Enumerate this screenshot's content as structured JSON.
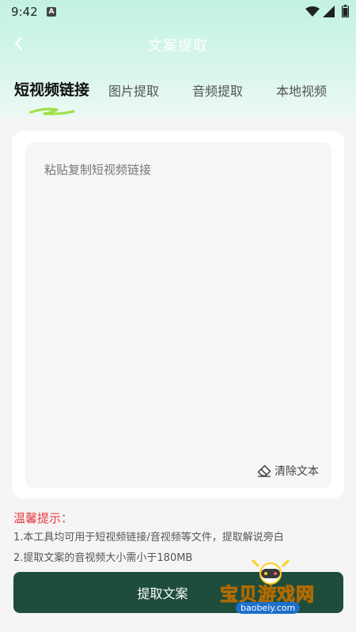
{
  "status_bar": {
    "time": "9:42",
    "app_badge": "A"
  },
  "header": {
    "title": "文案提取",
    "back_icon": "chevron-left-icon"
  },
  "tabs": [
    {
      "label": "短视频链接",
      "active": true
    },
    {
      "label": "图片提取",
      "active": false
    },
    {
      "label": "音频提取",
      "active": false
    },
    {
      "label": "本地视频",
      "active": false
    }
  ],
  "input": {
    "placeholder": "粘贴复制短视频链接",
    "value": ""
  },
  "clear_button": {
    "label": "清除文本",
    "icon": "eraser-icon"
  },
  "tips": {
    "title": "温馨提示：",
    "lines": [
      "1.本工具均可用于短视频链接/音视频等文件，提取解说旁白",
      "2.提取文案的音视频大小需小于180MB"
    ]
  },
  "submit_button": {
    "label": "提取文案"
  },
  "watermark": {
    "text": "宝贝游戏网",
    "url": "baobeiy.com"
  },
  "colors": {
    "header_gradient": "#c3f2e2",
    "tab_underline": "#9fe04a",
    "tips_title": "#e53b3b",
    "primary_button": "#1e4d3c",
    "watermark_text": "#ffcc1a"
  }
}
